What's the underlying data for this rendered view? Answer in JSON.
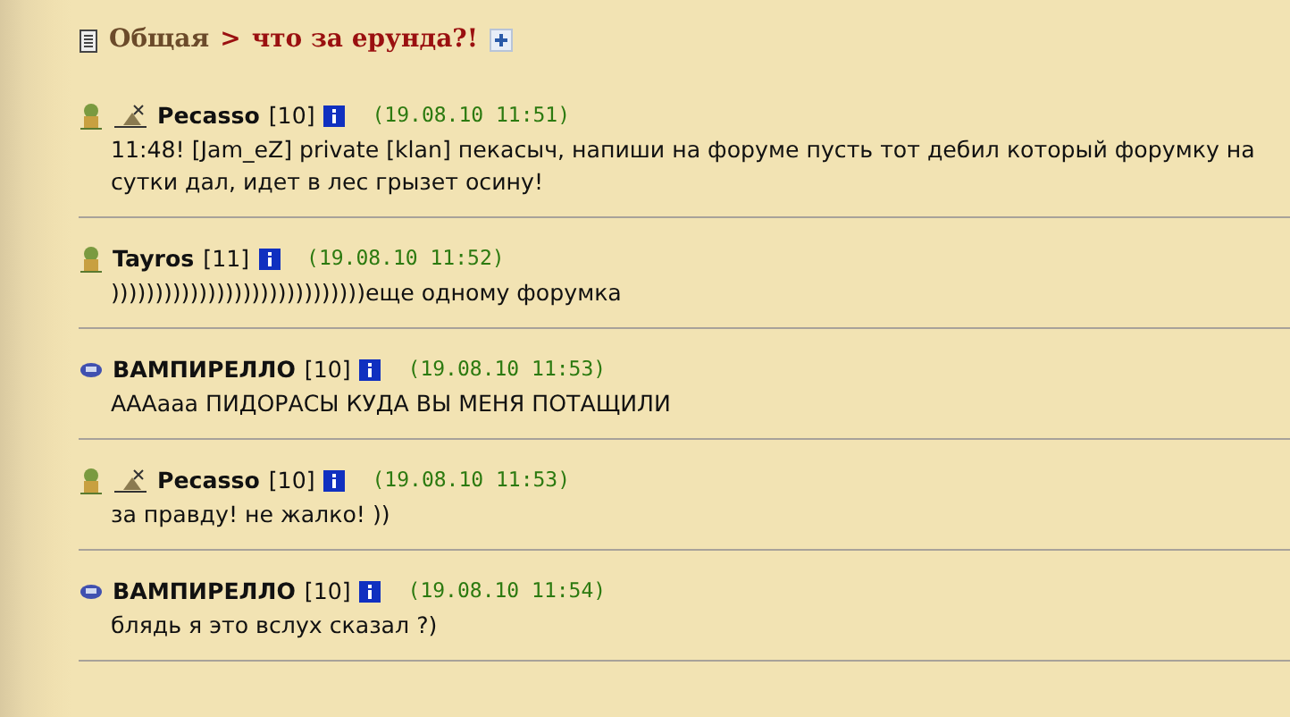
{
  "breadcrumb": {
    "section": "Общая",
    "separator": ">",
    "topic": "что за ерунда?!"
  },
  "posts": [
    {
      "kind": "figure",
      "clan_badge": true,
      "author": "Pecasso",
      "level": "[10]",
      "time": "(19.08.10 11:51)",
      "text": "11:48! [Jam_eZ] private [klan] пекасыч, напиши на форуме пусть тот дебил который форумку на сутки дал, идет в лес грызет осину!"
    },
    {
      "kind": "figure",
      "clan_badge": false,
      "author": "Tayros",
      "level": "[11]",
      "time": "(19.08.10 11:52)",
      "text": ")))))))))))))))))))))))))))))еще одному форумка"
    },
    {
      "kind": "mask",
      "clan_badge": false,
      "author": "ВАМПИРЕЛЛО",
      "level": "[10]",
      "time": "(19.08.10 11:53)",
      "text": "АААааа ПИДОРАСЫ КУДА ВЫ МЕНЯ ПОТАЩИЛИ"
    },
    {
      "kind": "figure",
      "clan_badge": true,
      "author": "Pecasso",
      "level": "[10]",
      "time": "(19.08.10 11:53)",
      "text": "за правду! не жалко! ))"
    },
    {
      "kind": "mask",
      "clan_badge": false,
      "author": "ВАМПИРЕЛЛО",
      "level": "[10]",
      "time": "(19.08.10 11:54)",
      "text": "блядь я это вслух сказал ?)"
    }
  ]
}
